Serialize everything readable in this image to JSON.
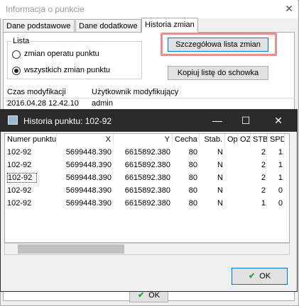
{
  "outer": {
    "title": "Informacja o punkcie",
    "close_glyph": "✕",
    "tabs": [
      "Dane podstawowe",
      "Dane dodatkowe",
      "Historia zmian"
    ],
    "group_label": "Lista",
    "radio_operator": "zmian operatu punktu",
    "radio_all": "wszystkich zmian punktu",
    "btn_detail": "Szczegółowa lista zmian",
    "btn_copy": "Kopiuj listę do schowka",
    "grid_col_time": "Czas modyfikacji",
    "grid_col_user": "Użytkownik modyfikujący",
    "grid_row_time": "2016.04.28 12.42.10",
    "grid_row_user": "admin",
    "ok": "OK"
  },
  "inner": {
    "title": "Historia punktu: 102-92",
    "min_glyph": "—",
    "max_glyph": "☐",
    "close_glyph": "✕",
    "columns": [
      "Numer punktu",
      "X",
      "Y",
      "Cecha",
      "Stab.",
      "Op",
      "OZ",
      "STB",
      "SPD"
    ],
    "rows": [
      [
        "102-92",
        "5699448.390",
        "6615892.380",
        "80",
        "N",
        "",
        "",
        "2",
        "1"
      ],
      [
        "102-92",
        "5699448.390",
        "6615892.380",
        "80",
        "N",
        "",
        "",
        "2",
        "1"
      ],
      [
        "102-92",
        "5699448.390",
        "6615892.380",
        "80",
        "N",
        "",
        "",
        "2",
        "1"
      ],
      [
        "102-92",
        "5699448.390",
        "6615892.380",
        "80",
        "N",
        "",
        "",
        "2",
        "0"
      ],
      [
        "102-92",
        "5699448.390",
        "6615892.380",
        "80",
        "N",
        "",
        "",
        "1",
        "0"
      ]
    ],
    "ok": "OK"
  },
  "colors": {
    "accent": "#0078d7",
    "title_dark": "#2b2b2b",
    "highlight": "#e98d8d"
  }
}
